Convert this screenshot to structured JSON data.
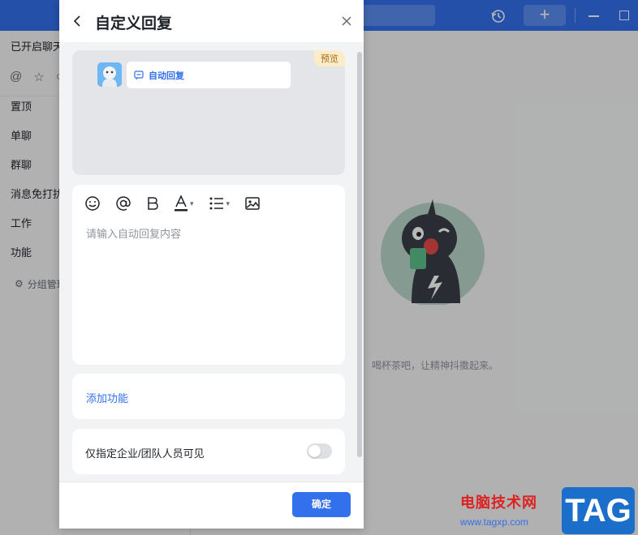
{
  "app": {
    "left_panel": {
      "header": "已开启聊天",
      "icons": [
        "at-icon",
        "star-icon",
        "circle-icon"
      ],
      "items": [
        {
          "label": "置顶"
        },
        {
          "label": "单聊"
        },
        {
          "label": "群聊"
        },
        {
          "label": "消息免打扰"
        },
        {
          "label": "工作"
        },
        {
          "label": "功能"
        }
      ],
      "sub_item": "分组管理"
    },
    "main": {
      "empty_tip": "喝杯茶吧，让精神抖擞起来。"
    }
  },
  "dialog": {
    "title": "自定义回复",
    "preview": {
      "badge": "预览",
      "bubble_text": "自动回复"
    },
    "editor": {
      "toolbar": [
        "emoji-icon",
        "mention-icon",
        "bold-icon",
        "text-color-icon",
        "list-icon",
        "image-icon"
      ],
      "placeholder": "请输入自动回复内容"
    },
    "add_function": "添加功能",
    "visibility": {
      "label": "仅指定企业/团队人员可见",
      "enabled": false
    },
    "confirm": "确定"
  },
  "watermark": {
    "text": "电脑技术网",
    "url": "www.tagxp.com",
    "tag": "TAG"
  },
  "colors": {
    "accent": "#3370eb",
    "topbar": "#3370eb"
  }
}
